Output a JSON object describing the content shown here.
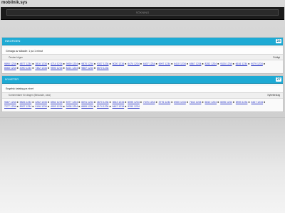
{
  "site": {
    "title": "mobilnik.sys"
  },
  "search": {
    "placeholder": "SÖKNING"
  },
  "panels": [
    {
      "title": "Inkorgen",
      "button": "28",
      "status": "Genaga av sökade: 1 pa 1 minut",
      "sub_left": "Önskar högen",
      "sub_right": "Förlägt",
      "links": [
        "9890 1234",
        "4877 1234",
        "3816 1234",
        "4714 1234",
        "9090 1234",
        "9870 1234",
        "9337 1234",
        "5020 1234",
        "6474 1234",
        "6407 1234",
        "6997 1234",
        "6410 1234",
        "6567 1234",
        "8252 1234",
        "9115 1234",
        "6616 1234",
        "9079 1234",
        "8668 1234",
        "4090 1234",
        "7352 1234",
        "9590 1234",
        "8221 1234",
        "9887 1234",
        "6570 1234"
      ]
    },
    {
      "title": "Nyheter",
      "button": "27",
      "status": "Engelsk katalog pa nivet",
      "sub_left": "Kommentarer för dragen (Belovade, vara)",
      "sub_right": "Nyheterdrag",
      "links": [
        "9667 1234",
        "5826 1234",
        "4262 1234",
        "6552 1234",
        "5977 1234",
        "6091 1234",
        "4670 1234",
        "3543 1234",
        "6595 1234",
        "7476 1234",
        "3776 1234",
        "6930 1234",
        "7642 1234",
        "6810 1234",
        "6055 1234",
        "8993 1234",
        "6447 1234",
        "7277 1234",
        "8937 1234",
        "9196 1234",
        "4903 1234",
        "9098 1234",
        "6689 1234",
        "8174 1234",
        "6467 1234",
        "9290 1234"
      ]
    }
  ]
}
